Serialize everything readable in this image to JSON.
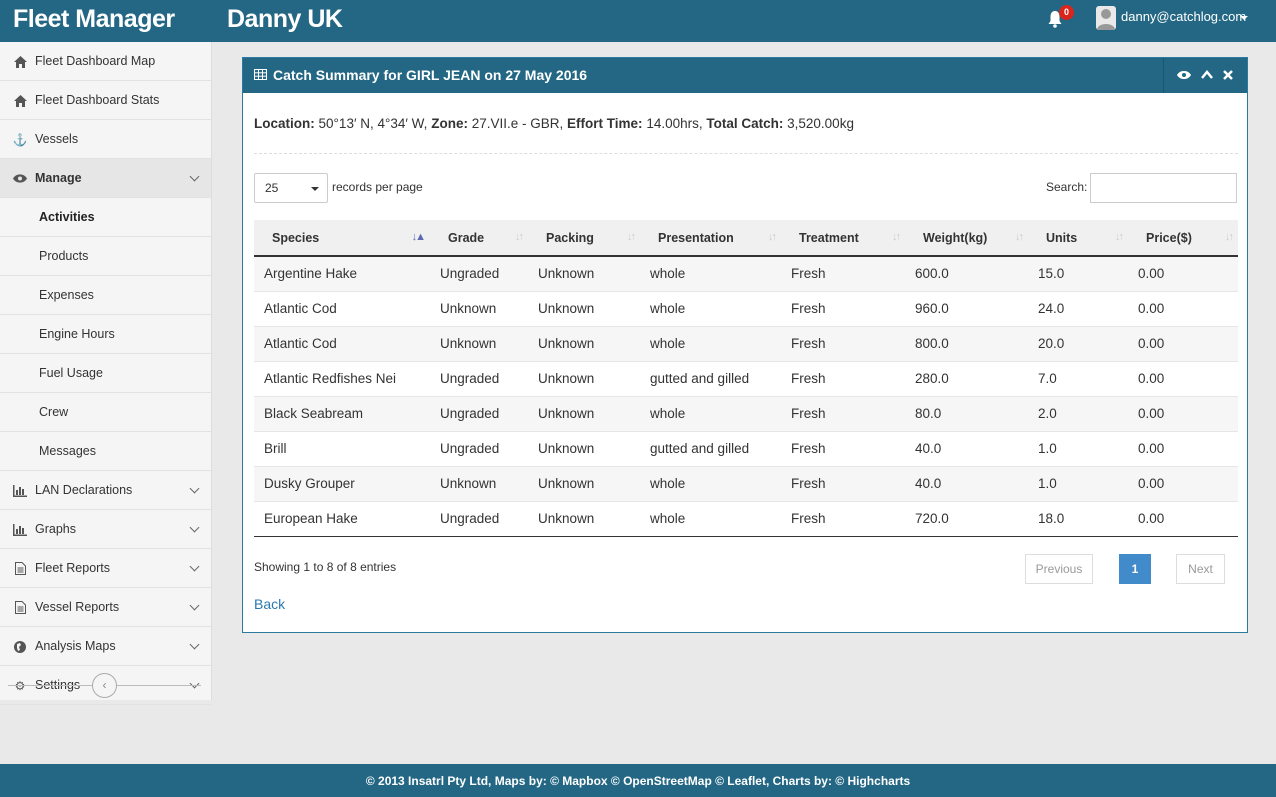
{
  "header": {
    "brand": "Fleet Manager",
    "company": "Danny UK",
    "notifications": "0",
    "user_email": "danny@catchlog.com"
  },
  "sidebar": {
    "items": [
      {
        "label": "Fleet Dashboard Map",
        "icon": "home-icon"
      },
      {
        "label": "Fleet Dashboard Stats",
        "icon": "home-icon"
      },
      {
        "label": "Vessels",
        "icon": "anchor-icon"
      },
      {
        "label": "Manage",
        "icon": "eye-icon"
      },
      {
        "label": "Activities"
      },
      {
        "label": "Products"
      },
      {
        "label": "Expenses"
      },
      {
        "label": "Engine Hours"
      },
      {
        "label": "Fuel Usage"
      },
      {
        "label": "Crew"
      },
      {
        "label": "Messages"
      },
      {
        "label": "LAN Declarations",
        "icon": "bar-chart-icon"
      },
      {
        "label": "Graphs",
        "icon": "bar-chart-icon"
      },
      {
        "label": "Fleet Reports",
        "icon": "file-icon"
      },
      {
        "label": "Vessel Reports",
        "icon": "file-icon"
      },
      {
        "label": "Analysis Maps",
        "icon": "globe-icon"
      },
      {
        "label": "Settings",
        "icon": "cogs-icon"
      }
    ]
  },
  "panel": {
    "title": "Catch Summary for GIRL JEAN on 27 May 2016",
    "summary": {
      "location_label": "Location:",
      "location": "50°13′ N, 4°34′ W,",
      "zone_label": "Zone:",
      "zone": "27.VII.e - GBR,",
      "effort_label": "Effort Time:",
      "effort": "14.00hrs,",
      "total_label": "Total Catch:",
      "total": "3,520.00kg"
    },
    "page_length": "25",
    "records_per_page": "records per page",
    "search_label": "Search:",
    "columns": [
      "Species",
      "Grade",
      "Packing",
      "Presentation",
      "Treatment",
      "Weight(kg)",
      "Units",
      "Price($)"
    ],
    "rows": [
      [
        "Argentine Hake",
        "Ungraded",
        "Unknown",
        "whole",
        "Fresh",
        "600.0",
        "15.0",
        "0.00"
      ],
      [
        "Atlantic Cod",
        "Unknown",
        "Unknown",
        "whole",
        "Fresh",
        "960.0",
        "24.0",
        "0.00"
      ],
      [
        "Atlantic Cod",
        "Unknown",
        "Unknown",
        "whole",
        "Fresh",
        "800.0",
        "20.0",
        "0.00"
      ],
      [
        "Atlantic Redfishes Nei",
        "Ungraded",
        "Unknown",
        "gutted and gilled",
        "Fresh",
        "280.0",
        "7.0",
        "0.00"
      ],
      [
        "Black Seabream",
        "Ungraded",
        "Unknown",
        "whole",
        "Fresh",
        "80.0",
        "2.0",
        "0.00"
      ],
      [
        "Brill",
        "Ungraded",
        "Unknown",
        "gutted and gilled",
        "Fresh",
        "40.0",
        "1.0",
        "0.00"
      ],
      [
        "Dusky Grouper",
        "Unknown",
        "Unknown",
        "whole",
        "Fresh",
        "40.0",
        "1.0",
        "0.00"
      ],
      [
        "European Hake",
        "Ungraded",
        "Unknown",
        "whole",
        "Fresh",
        "720.0",
        "18.0",
        "0.00"
      ]
    ],
    "info": "Showing 1 to 8 of 8 entries",
    "pagination": {
      "previous": "Previous",
      "page": "1",
      "next": "Next"
    },
    "back": "Back"
  },
  "footer": "© 2013 Insatrl Pty Ltd, Maps by: © Mapbox © OpenStreetMap © Leaflet, Charts by: © Highcharts",
  "colors": {
    "header": "#236784",
    "accent": "#428bca",
    "badge": "#d9261c"
  }
}
